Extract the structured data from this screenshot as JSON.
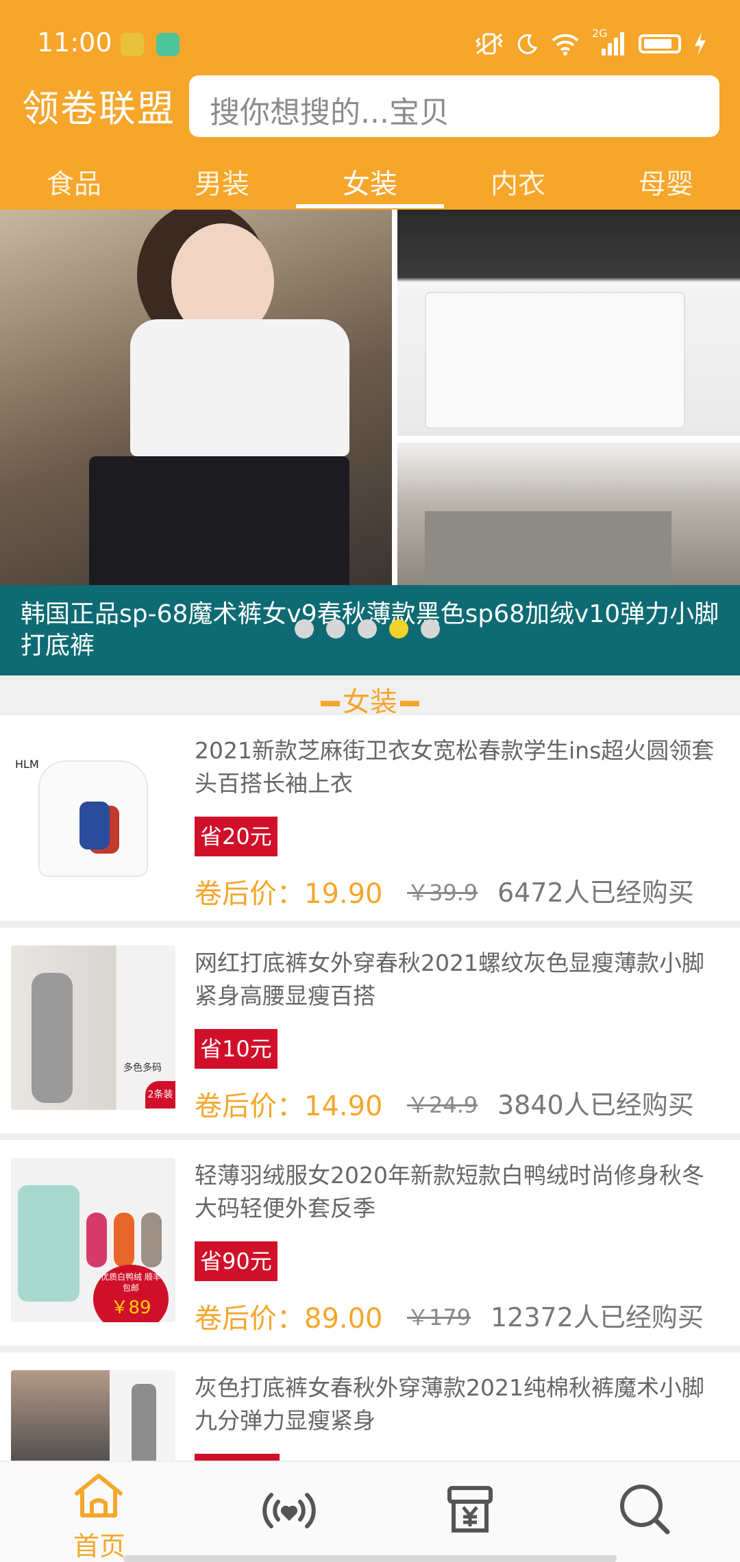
{
  "status_bar": {
    "time": "11:00",
    "network": "2G"
  },
  "header": {
    "app_title": "领卷联盟",
    "search_placeholder": "搜你想搜的...宝贝"
  },
  "tabs": [
    "食品",
    "男装",
    "女装",
    "内衣",
    "母婴"
  ],
  "active_tab": "女装",
  "banner": {
    "caption": "韩国正品sp-68魔术裤女v9春秋薄款黑色sp68加绒v10弹力小脚打底裤",
    "dot_count": 5,
    "active_dot": 4
  },
  "section": {
    "title": "女装"
  },
  "products": [
    {
      "title": "2021新款芝麻街卫衣女宽松春款学生ins超火圆领套头百搭长袖上衣",
      "save": "省20元",
      "price": "卷后价：19.90",
      "original": "￥39.9",
      "sold": "6472人已经购买",
      "thumb_text": "HLM"
    },
    {
      "title": "网红打底裤女外穿春秋2021螺纹灰色显瘦薄款小脚紧身高腰显瘦百搭",
      "save": "省10元",
      "price": "卷后价：14.90",
      "original": "￥24.9",
      "sold": "3840人已经购买",
      "thumb_text": "多色多码",
      "thumb_badge": "2条装"
    },
    {
      "title": "轻薄羽绒服女2020年新款短款白鸭绒时尚修身秋冬大码轻便外套反季",
      "save": "省90元",
      "price": "卷后价：89.00",
      "original": "￥179",
      "sold": "12372人已经购买",
      "thumb_text": "优质白鸭绒 顺丰包邮",
      "thumb_price": "￥89"
    },
    {
      "title": "灰色打底裤女春秋外穿薄款2021纯棉秋裤魔术小脚九分弹力显瘦紧身",
      "save": "",
      "price": "",
      "original": "",
      "sold": ""
    }
  ],
  "bottom_nav": {
    "items": [
      {
        "label": "首页",
        "icon": "home-icon",
        "active": true
      },
      {
        "label": "",
        "icon": "broadcast-heart-icon",
        "active": false
      },
      {
        "label": "",
        "icon": "yen-box-icon",
        "active": false
      },
      {
        "label": "",
        "icon": "search-icon",
        "active": false
      }
    ]
  },
  "colors": {
    "brand": "#F6A62B",
    "caption_bg": "#0E6B74",
    "save_badge": "#D0102A",
    "active_dot": "#F2D32A"
  }
}
